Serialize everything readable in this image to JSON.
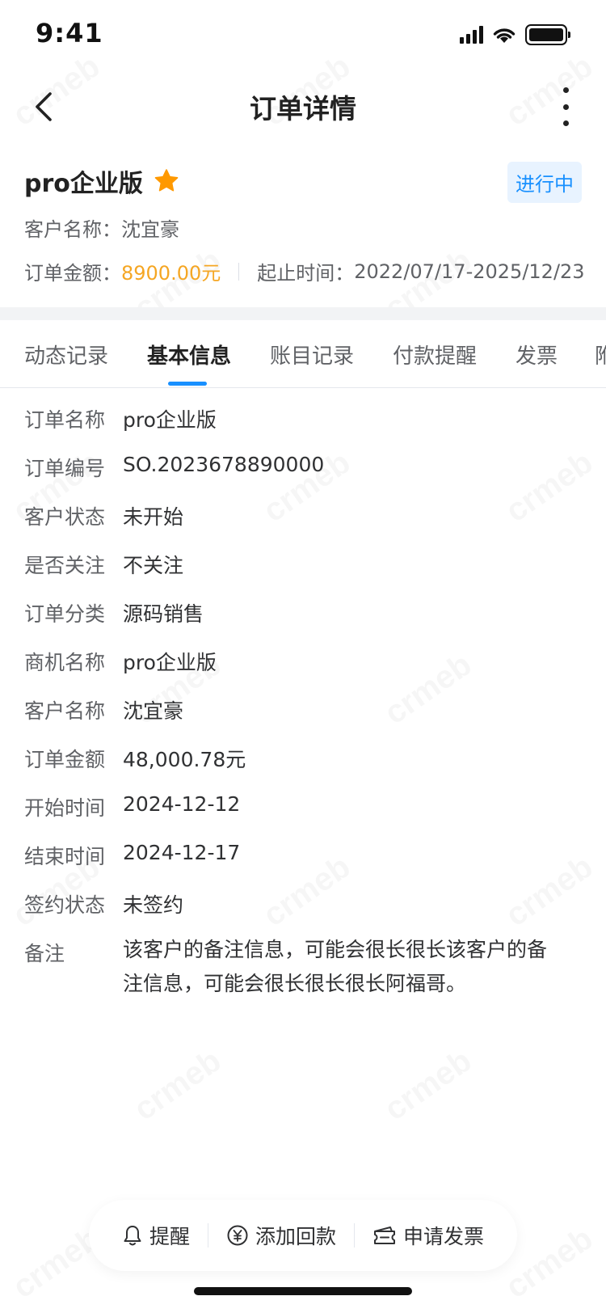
{
  "status_bar": {
    "time": "9:41"
  },
  "nav": {
    "title": "订单详情"
  },
  "header": {
    "order_name": "pro企业版",
    "status_badge": "进行中",
    "customer_label": "客户名称：",
    "customer_value": "沈宜豪",
    "amount_label": "订单金额：",
    "amount_value": "8900.00元",
    "period_label": "起止时间：",
    "period_value": "2022/07/17-2025/12/23"
  },
  "tabs": [
    "动态记录",
    "基本信息",
    "账目记录",
    "付款提醒",
    "发票",
    "附"
  ],
  "active_tab": "基本信息",
  "info_rows": [
    {
      "label": "订单名称",
      "value": "pro企业版"
    },
    {
      "label": "订单编号",
      "value": "SO.2023678890000"
    },
    {
      "label": "客户状态",
      "value": "未开始"
    },
    {
      "label": "是否关注",
      "value": "不关注"
    },
    {
      "label": "订单分类",
      "value": "源码销售"
    },
    {
      "label": "商机名称",
      "value": "pro企业版"
    },
    {
      "label": "客户名称",
      "value": "沈宜豪"
    },
    {
      "label": "订单金额",
      "value": "48,000.78元"
    },
    {
      "label": "开始时间",
      "value": "2024-12-12"
    },
    {
      "label": "结束时间",
      "value": "2024-12-17"
    },
    {
      "label": "签约状态",
      "value": "未签约"
    },
    {
      "label": "备注",
      "value": "该客户的备注信息，可能会很长很长该客户的备注信息，可能会很长很长很长阿福哥。"
    }
  ],
  "actions": {
    "remind": "提醒",
    "add_payment": "添加回款",
    "apply_invoice": "申请发票"
  },
  "watermark_text": "crmeb",
  "colors": {
    "accent": "#1890ff",
    "amount": "#f5a623",
    "star": "#ff9900",
    "badge_bg": "#e8f3ff"
  }
}
